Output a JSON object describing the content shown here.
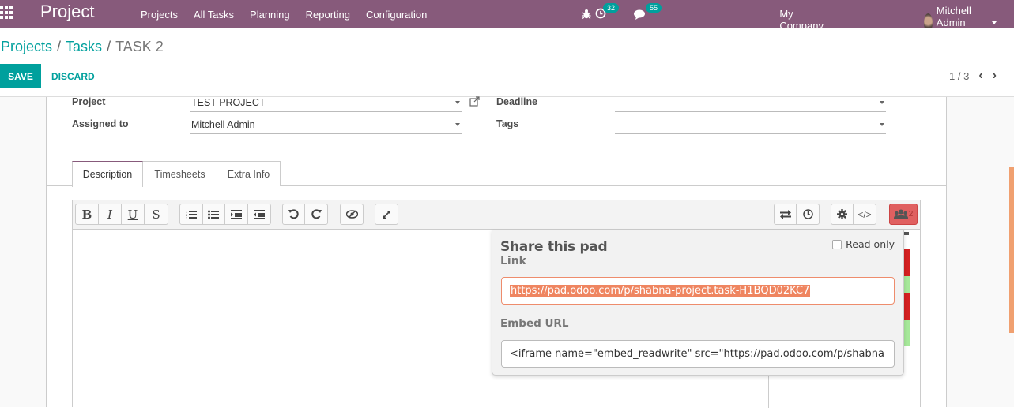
{
  "navbar": {
    "app_title": "Project",
    "menu": [
      "Projects",
      "All Tasks",
      "Planning",
      "Reporting",
      "Configuration"
    ],
    "activities_count": "32",
    "messages_count": "55",
    "company": "My Company (San Francisco)",
    "user": "Mitchell Admin (shabna)"
  },
  "breadcrumb": {
    "items": [
      "Projects",
      "Tasks"
    ],
    "current": "TASK 2",
    "separator": "/"
  },
  "actions": {
    "save_label": "SAVE",
    "discard_label": "DISCARD"
  },
  "pager": {
    "value": "1 / 3"
  },
  "form": {
    "project_label": "Project",
    "project_value": "TEST PROJECT",
    "assigned_label": "Assigned to",
    "assigned_value": "Mitchell Admin",
    "deadline_label": "Deadline",
    "deadline_value": "",
    "tags_label": "Tags",
    "tags_value": ""
  },
  "tabs": [
    {
      "label": "Description",
      "active": true
    },
    {
      "label": "Timesheets",
      "active": false
    },
    {
      "label": "Extra Info",
      "active": false
    }
  ],
  "editor": {
    "users_count": "2"
  },
  "share_popup": {
    "title": "Share this pad",
    "readonly_label": "Read only",
    "readonly_checked": false,
    "link_label": "Link",
    "link_value": "https://pad.odoo.com/p/shabna-project.task-H1BQD02KC7",
    "embed_label": "Embed URL",
    "embed_value": "<iframe name=\"embed_readwrite\" src=\"https://pad.odoo.com/p/shabna"
  },
  "colors": {
    "brand": "#875a7b",
    "accent": "#00a09d",
    "selection": "#ef8560",
    "users_button": "#e06060"
  }
}
